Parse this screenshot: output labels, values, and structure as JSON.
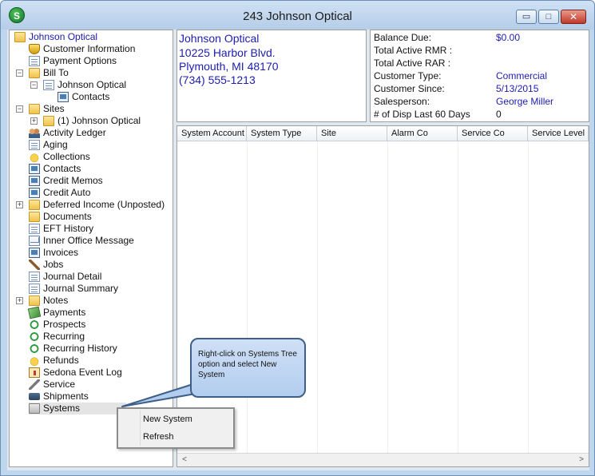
{
  "window": {
    "title": "243  Johnson Optical",
    "app_icon_letter": "S",
    "minimize_glyph": "▭",
    "maximize_glyph": "□",
    "close_glyph": "✕"
  },
  "tree": {
    "items": [
      {
        "label": "Johnson Optical",
        "icon": "folder-icon"
      },
      {
        "label": "Customer Information",
        "icon": "shield-icon"
      },
      {
        "label": "Payment Options",
        "icon": "document-icon"
      },
      {
        "label": "Bill To",
        "icon": "folder-icon"
      },
      {
        "label": "Johnson Optical",
        "icon": "document-icon"
      },
      {
        "label": "Contacts",
        "icon": "screen-icon"
      },
      {
        "label": "Sites",
        "icon": "folder-icon"
      },
      {
        "label": "(1) Johnson Optical",
        "icon": "folder-icon"
      },
      {
        "label": "Activity Ledger",
        "icon": "people-icon"
      },
      {
        "label": "Aging",
        "icon": "document-icon"
      },
      {
        "label": "Collections",
        "icon": "coins-icon"
      },
      {
        "label": "Contacts",
        "icon": "screen-icon"
      },
      {
        "label": "Credit Memos",
        "icon": "screen-icon"
      },
      {
        "label": "Credit Auto",
        "icon": "screen-icon"
      },
      {
        "label": "Deferred Income (Unposted)",
        "icon": "folder-icon"
      },
      {
        "label": "Documents",
        "icon": "folder-icon"
      },
      {
        "label": "EFT History",
        "icon": "document-icon"
      },
      {
        "label": "Inner Office Message",
        "icon": "mail-icon"
      },
      {
        "label": "Invoices",
        "icon": "screen-icon"
      },
      {
        "label": "Jobs",
        "icon": "hammer-icon"
      },
      {
        "label": "Journal Detail",
        "icon": "document-icon"
      },
      {
        "label": "Journal Summary",
        "icon": "document-icon"
      },
      {
        "label": "Notes",
        "icon": "folder-icon"
      },
      {
        "label": "Payments",
        "icon": "money-icon"
      },
      {
        "label": "Prospects",
        "icon": "recurring-icon"
      },
      {
        "label": "Recurring",
        "icon": "recurring-icon"
      },
      {
        "label": "Recurring History",
        "icon": "recurring-icon"
      },
      {
        "label": "Refunds",
        "icon": "coins-icon"
      },
      {
        "label": "Sedona Event Log",
        "icon": "event-icon"
      },
      {
        "label": "Service",
        "icon": "tool-icon"
      },
      {
        "label": "Shipments",
        "icon": "truck-icon"
      },
      {
        "label": "Systems",
        "icon": "systems-icon"
      }
    ]
  },
  "address": {
    "name": "Johnson Optical",
    "street": "10225 Harbor Blvd.",
    "city_state_zip": "Plymouth, MI 48170",
    "phone": "(734) 555-1213"
  },
  "summary": {
    "rows": [
      {
        "label": "Balance Due:",
        "value": "$0.00"
      },
      {
        "label": "Total Active RMR :",
        "value": ""
      },
      {
        "label": "Total Active RAR :",
        "value": ""
      },
      {
        "label": "Customer Type:",
        "value": "Commercial"
      },
      {
        "label": "Customer Since:",
        "value": "5/13/2015"
      },
      {
        "label": "Salesperson:",
        "value": "George Miller"
      },
      {
        "label": "# of Disp Last 60 Days",
        "value": "0"
      }
    ]
  },
  "grid": {
    "columns": [
      "System Account",
      "System Type",
      "Site",
      "Alarm Co",
      "Service Co",
      "Service Level"
    ],
    "scroll_left_glyph": "<",
    "scroll_right_glyph": ">"
  },
  "context_menu": {
    "items": [
      "New System",
      "Refresh"
    ]
  },
  "callout": {
    "text": "Right-click on Systems Tree option and select New System"
  },
  "colors": {
    "link_blue": "#1d1db0",
    "window_frame": "#bfd7ee",
    "callout_fill": "#b3cdef"
  }
}
